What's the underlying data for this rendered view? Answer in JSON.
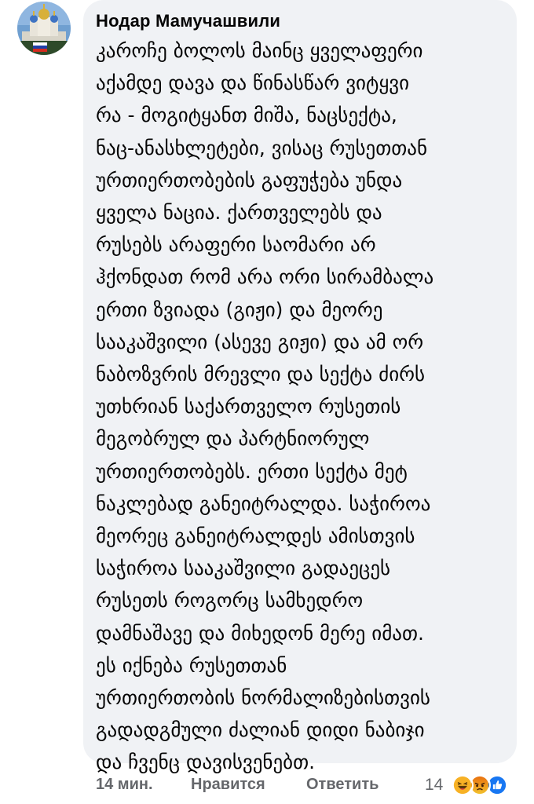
{
  "comment": {
    "author": "Нодар Мамучашвили",
    "text_lines": [
      "კაროჩე ბოლოს მაინც ყველაფერი",
      "აქამდე დავა და წინასწარ ვიტყვი",
      "რა - მოგიტყანთ მიშა, ნაცსექტა,",
      "ნაც-ანასხლეტები, ვისაც რუსეთთან",
      "ურთიერთობების გაფუჭება უნდა",
      "ყველა ნაცია. ქართველებს და",
      "რუსებს არაფერი საომარი არ",
      "ჰქონდათ რომ არა ორი სირამბალა",
      "ერთი ზვიადა (გიჟი) და მეორე",
      "სააკაშვილი (ასევე გიჟი) და ამ ორ",
      "ნაბოზვრის მრევლი და სექტა ძირს",
      "უთხრიან საქართველო რუსეთის",
      "მეგობრულ და პარტნიორულ",
      "ურთიერთობებს. ერთი სექტა მეტ",
      "ნაკლებად განეიტრალდა. საჭიროა",
      "მეორეც განეიტრალდეს ამისთვის",
      "საჭიროა სააკაშვილი გადაეცეს",
      "რუსეთს როგორც სამხედრო",
      "დამნაშავე და მიხედონ მერე იმათ.",
      "ეს იქნება რუსეთთან",
      "ურთიერთობის ნორმალიზებისთვის",
      "გადადგმული ძალიან დიდი ნაბიჯი",
      "და ჩვენც დავისვენებთ."
    ]
  },
  "footer": {
    "time": "14 мин.",
    "like_label": "Нравится",
    "reply_label": "Ответить",
    "reaction_count": "14"
  },
  "reactions": [
    "haha-icon",
    "angry-icon",
    "like-icon"
  ],
  "colors": {
    "bubble": "#f0f2f5",
    "meta_text": "#65676b",
    "like_blue": "#1877f2",
    "angry_orange": "#e9710f",
    "haha_yellow": "#f7b125"
  }
}
